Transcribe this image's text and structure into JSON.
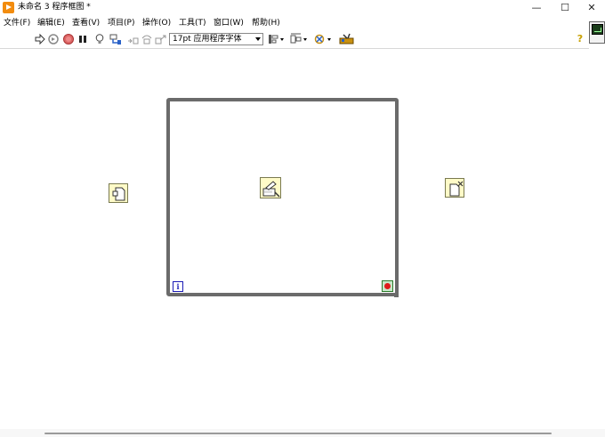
{
  "window": {
    "title": "未命名 3 程序框图 *",
    "minimize_glyph": "—",
    "maximize_glyph": "☐",
    "close_glyph": "✕"
  },
  "menu": {
    "items": [
      "文件(F)",
      "编辑(E)",
      "查看(V)",
      "项目(P)",
      "操作(O)",
      "工具(T)",
      "窗口(W)",
      "帮助(H)"
    ]
  },
  "toolbar": {
    "buttons": [
      "run-arrow-icon",
      "run-continuously-icon",
      "abort-icon",
      "pause-icon",
      "highlight-execution-icon",
      "retain-wire-values-icon",
      "step-into-icon",
      "step-over-icon",
      "step-out-icon"
    ],
    "font_select_value": "17pt 应用程序字体",
    "align_buttons": [
      "align-objects-icon",
      "distribute-objects-icon",
      "reorder-icon",
      "cleanup-diagram-icon"
    ],
    "help_glyph": "?"
  },
  "diagram": {
    "nodes": [
      "open-file-node-icon",
      "loop-subvi-node-icon",
      "close-file-node-icon"
    ],
    "iteration_label": "i",
    "stop_terminal": "stop-terminal-icon"
  },
  "colors": {
    "node_fill": "#fffbc8",
    "loop_border": "#6b6b6b",
    "app_icon": "#f28c0f",
    "iteration_blue": "#1b1bb5",
    "stop_red": "#e01b1b"
  }
}
